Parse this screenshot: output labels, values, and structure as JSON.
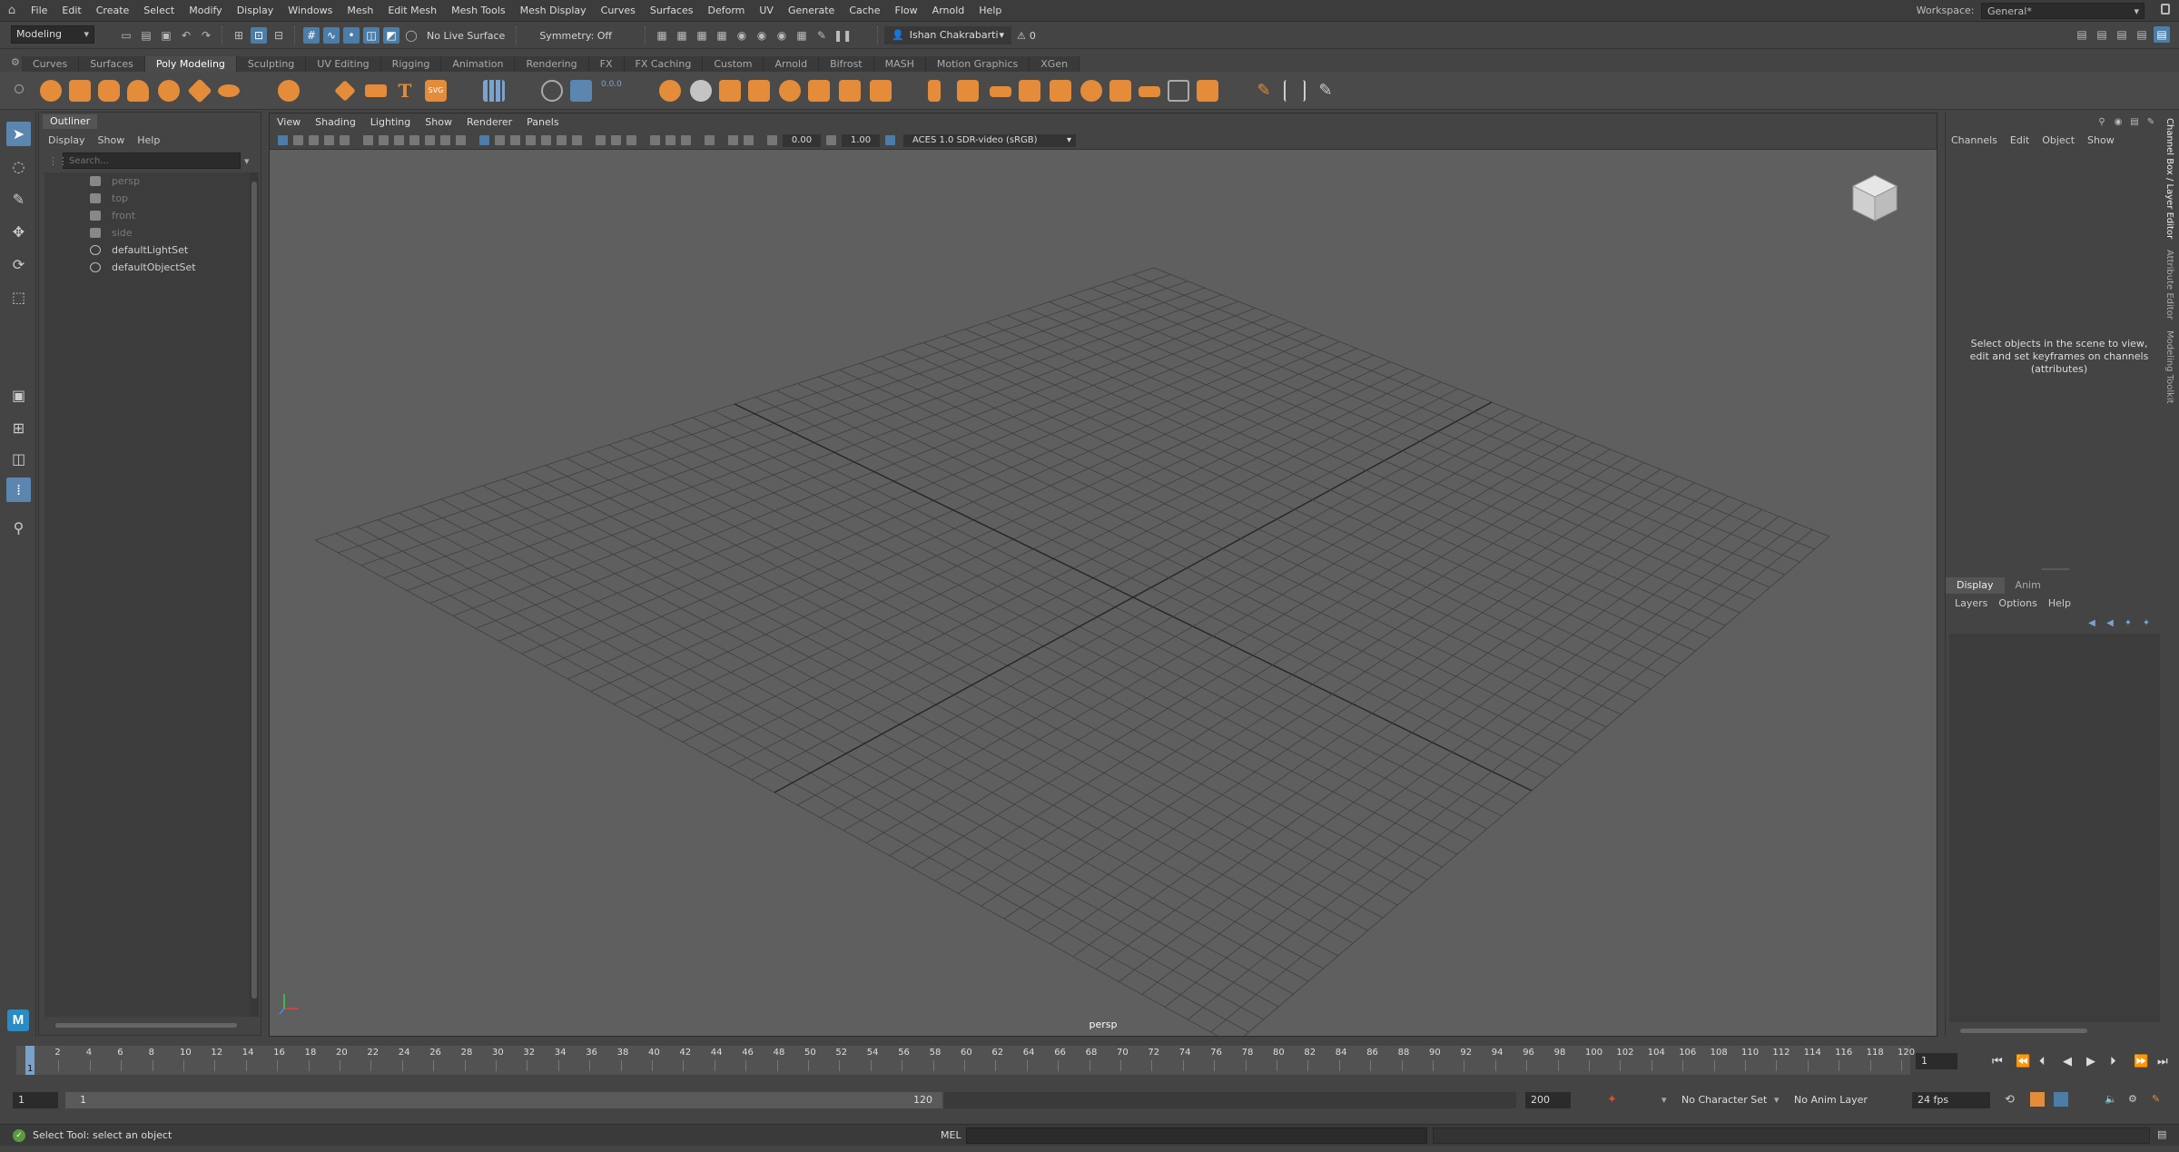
{
  "menubar": {
    "items": [
      "File",
      "Edit",
      "Create",
      "Select",
      "Modify",
      "Display",
      "Windows",
      "Mesh",
      "Edit Mesh",
      "Mesh Tools",
      "Mesh Display",
      "Curves",
      "Surfaces",
      "Deform",
      "UV",
      "Generate",
      "Cache",
      "Flow",
      "Arnold",
      "Help"
    ],
    "workspace_label": "Workspace:",
    "workspace_value": "General*"
  },
  "statusline": {
    "mode": "Modeling",
    "live_surface": "No Live Surface",
    "symmetry": "Symmetry: Off",
    "user": "Ishan Chakrabarti",
    "warnings": "0"
  },
  "shelf": {
    "tabs": [
      "Curves",
      "Surfaces",
      "Poly Modeling",
      "Sculpting",
      "UV Editing",
      "Rigging",
      "Animation",
      "Rendering",
      "FX",
      "FX Caching",
      "Custom",
      "Arnold",
      "Bifrost",
      "MASH",
      "Motion Graphics",
      "XGen"
    ],
    "active_tab": "Poly Modeling",
    "svg_label": "SVG",
    "text_label": "T"
  },
  "outliner": {
    "title": "Outliner",
    "menu": [
      "Display",
      "Show",
      "Help"
    ],
    "search_placeholder": "Search...",
    "items": [
      {
        "label": "persp",
        "icon": "camera-icon",
        "dim": true
      },
      {
        "label": "top",
        "icon": "camera-icon",
        "dim": true
      },
      {
        "label": "front",
        "icon": "camera-icon",
        "dim": true
      },
      {
        "label": "side",
        "icon": "camera-icon",
        "dim": true
      },
      {
        "label": "defaultLightSet",
        "icon": "set-icon",
        "dim": false
      },
      {
        "label": "defaultObjectSet",
        "icon": "set-icon",
        "dim": false
      }
    ]
  },
  "viewport": {
    "menu": [
      "View",
      "Shading",
      "Lighting",
      "Show",
      "Renderer",
      "Panels"
    ],
    "exposure": "0.00",
    "gamma": "1.00",
    "color_space": "ACES 1.0 SDR-video (sRGB)",
    "camera_label": "persp"
  },
  "channelbox": {
    "menu": [
      "Channels",
      "Edit",
      "Object",
      "Show"
    ],
    "message": "Select objects in the scene to view, edit and set keyframes on channels (attributes)",
    "tabs": [
      "Display",
      "Anim"
    ],
    "layer_menu": [
      "Layers",
      "Options",
      "Help"
    ],
    "side_tabs": [
      "Channel Box / Layer Editor",
      "Attribute Editor",
      "Modeling Toolkit"
    ]
  },
  "timeslider": {
    "ticks": [
      "2",
      "4",
      "6",
      "8",
      "10",
      "12",
      "14",
      "16",
      "18",
      "20",
      "22",
      "24",
      "26",
      "28",
      "30",
      "32",
      "34",
      "36",
      "38",
      "40",
      "42",
      "44",
      "46",
      "48",
      "50",
      "52",
      "54",
      "56",
      "58",
      "60",
      "62",
      "64",
      "66",
      "68",
      "70",
      "72",
      "74",
      "76",
      "78",
      "80",
      "82",
      "84",
      "86",
      "88",
      "90",
      "92",
      "94",
      "96",
      "98",
      "100",
      "102",
      "104",
      "106",
      "108",
      "110",
      "112",
      "114",
      "116",
      "118",
      "120"
    ],
    "current_frame_marker": "1",
    "current_frame": "1"
  },
  "rangeslider": {
    "start": "1",
    "range_start": "1",
    "range_end": "120",
    "end": "200",
    "character_set": "No Character Set",
    "anim_layer": "No Anim Layer",
    "fps": "24 fps"
  },
  "cmdline": {
    "help_text": "Select Tool: select an object",
    "mel_label": "MEL"
  },
  "logo": "M",
  "colors": {
    "accent_orange": "#e48c3a",
    "accent_blue": "#5a86b0",
    "viewport_bg": "#5f5f5f"
  }
}
